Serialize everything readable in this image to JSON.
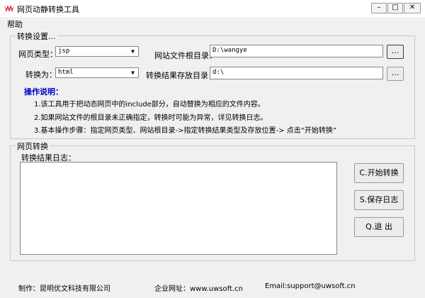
{
  "window": {
    "title": "网页动静转换工具",
    "minimize_label": "–",
    "maximize_label": "□",
    "close_label": "✕"
  },
  "menu": {
    "help": "帮助"
  },
  "settings": {
    "legend": "转换设置...",
    "page_type_label": "网页类型：",
    "page_type_value": "jsp",
    "site_root_label": "网站文件根目录：",
    "site_root_value": "D:\\wangye",
    "browse_label": "...",
    "convert_to_label": "转换为：",
    "convert_to_value": "html",
    "output_dir_label": "转换结果存放目录：",
    "output_dir_value": "d:\\",
    "notes_title": "操作说明：",
    "notes": [
      "1.该工具用于把动态网页中的include部分，自动替换为相应的文件内容。",
      "2.如果网站文件的根目录未正确指定，转换时可能为异常，详见转换日志。",
      "3.基本操作步骤：指定网页类型、网站根目录->指定转换结果类型及存放位置-> 点击“开始转换”"
    ]
  },
  "convert": {
    "legend": "网页转换",
    "log_label": "转换结果日志：",
    "start_button": "C.开始转换",
    "save_button": "S.保存日志",
    "exit_button": "Q.退  出"
  },
  "footer": {
    "maker": "制作：昆明优文科技有限公司",
    "website": "企业网址：www.uwsoft.cn",
    "email": "Email:support@uwsoft.cn"
  }
}
